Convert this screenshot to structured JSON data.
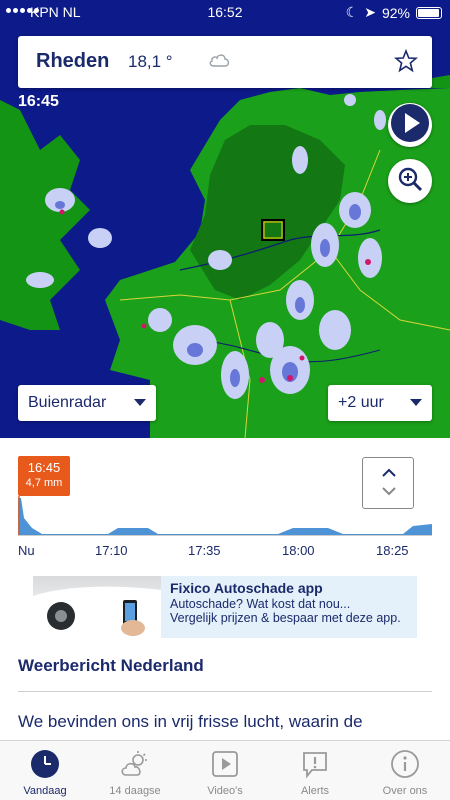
{
  "status_bar": {
    "carrier": "KPN NL",
    "time": "16:52",
    "battery": "92%"
  },
  "location": {
    "city": "Rheden",
    "temperature": "18,1 °",
    "weather_icon": "cloud-icon",
    "favorite_icon": "star-outline-icon"
  },
  "map": {
    "time": "16:45",
    "play_icon": "play-icon",
    "zoom_icon": "zoom-in-icon",
    "layer_selector": "Buienradar",
    "time_selector": "+2 uur"
  },
  "graph": {
    "now_time": "16:45",
    "now_value": "4,7 mm",
    "x_labels": [
      "Nu",
      "17:10",
      "17:35",
      "18:00",
      "18:25"
    ],
    "expand_icon": "chevron-up-down-icon",
    "colors": {
      "badge": "#e85a1b",
      "fill": "#4d93d6"
    }
  },
  "ad": {
    "title": "Fixico Autoschade app",
    "line1": "Autoschade? Wat kost dat nou...",
    "line2": "Vergelijk prijzen & bespaar met deze app."
  },
  "report": {
    "title": "Weerbericht Nederland",
    "text": "We bevinden ons in vrij frisse lucht, waarin de"
  },
  "tabs": [
    {
      "label": "Vandaag",
      "icon": "clock-icon",
      "active": true
    },
    {
      "label": "14 daagse",
      "icon": "sun-cloud-icon",
      "active": false
    },
    {
      "label": "Video's",
      "icon": "video-icon",
      "active": false
    },
    {
      "label": "Alerts",
      "icon": "alert-bubble-icon",
      "active": false
    },
    {
      "label": "Over ons",
      "icon": "info-icon",
      "active": false
    }
  ],
  "theme": {
    "primary": "#1b2a6b",
    "sea": "#0c1a8a",
    "land": "#1a9a1a"
  }
}
